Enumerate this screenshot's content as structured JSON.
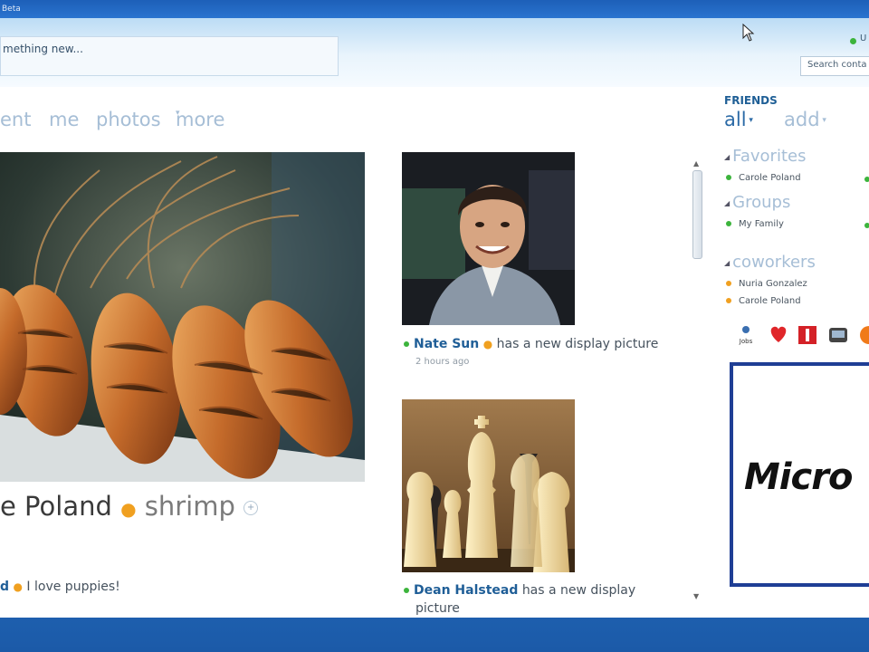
{
  "window": {
    "title": "Beta"
  },
  "header": {
    "status_placeholder": "mething new...",
    "presence_label": "U",
    "search_contacts_placeholder": "Search conta"
  },
  "tabs": [
    {
      "label": "ent"
    },
    {
      "label": "me"
    },
    {
      "label": "photos"
    },
    {
      "label": "more"
    }
  ],
  "main": {
    "featured": {
      "name": "e Poland",
      "tag": "shrimp"
    },
    "status_update": {
      "name": "d",
      "text": "I love puppies!"
    }
  },
  "feed": [
    {
      "name": "Nate Sun",
      "text": "has a new display picture",
      "time": "2 hours ago"
    },
    {
      "name": "Dean Halstead",
      "text": "has a new display",
      "text2": "picture"
    }
  ],
  "friends": {
    "title": "FRIENDS",
    "view_all": "all",
    "add": "add",
    "groups": [
      {
        "label": "Favorites",
        "contacts": [
          {
            "name": "Carole Poland",
            "status": "online"
          }
        ]
      },
      {
        "label": "Groups",
        "contacts": [
          {
            "name": "My Family",
            "status": "online"
          }
        ]
      },
      {
        "label": "coworkers",
        "contacts": [
          {
            "name": "Nuria Gonzalez",
            "status": "away"
          },
          {
            "name": "Carole Poland",
            "status": "away"
          }
        ]
      }
    ],
    "tool_badge": "Jobs"
  },
  "ad": {
    "text": "Micro"
  },
  "colors": {
    "accent": "#1f5e97",
    "online": "#3cb43c",
    "away": "#f0a020",
    "taskbar": "#2f7ed3"
  }
}
